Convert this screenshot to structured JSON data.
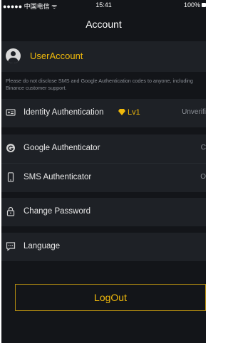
{
  "status_bar": {
    "carrier": "●●●●● 中国电信 ᯤ",
    "time": "15:41",
    "battery": "100%"
  },
  "header": {
    "title": "Account"
  },
  "user": {
    "name": "UserAccount"
  },
  "warning_text": "Please do not disclose SMS and Google Authentication codes to anyone, including Binance customer support.",
  "menu": {
    "identity": {
      "label": "Identity Authentication",
      "level": "Lv1",
      "status": "Unverifi"
    },
    "google": {
      "label": "Google Authenticator",
      "status": "C"
    },
    "sms": {
      "label": "SMS Authenticator",
      "status": "O"
    },
    "password": {
      "label": "Change Password"
    },
    "language": {
      "label": "Language"
    }
  },
  "logout_label": "LogOut",
  "colors": {
    "accent": "#f0b90b",
    "background": "#131519",
    "row": "#1e2126"
  }
}
